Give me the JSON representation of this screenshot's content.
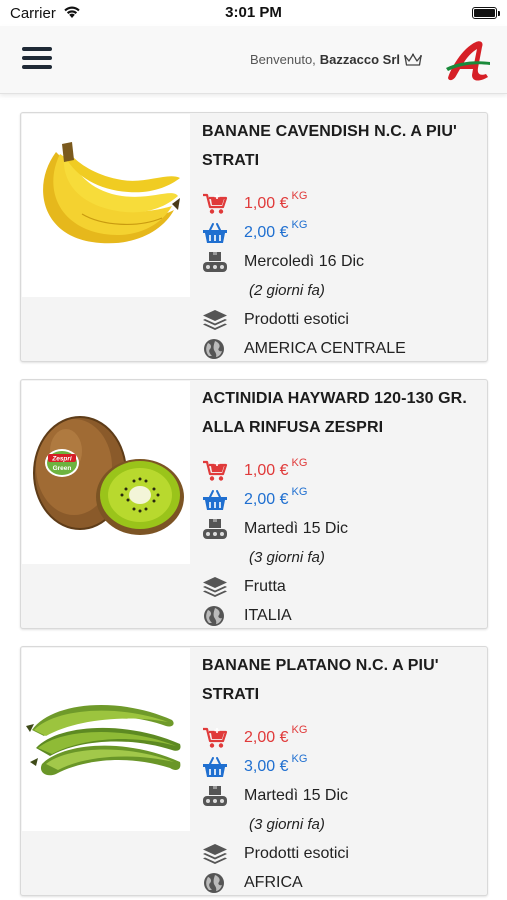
{
  "status_bar": {
    "carrier": "Carrier",
    "time": "3:01 PM"
  },
  "header": {
    "welcome": "Benvenuto,",
    "user": "Bazzacco Srl"
  },
  "products": [
    {
      "title": "BANANE CAVENDISH N.C. A PIU' STRATI",
      "sell_price": "1,00 €",
      "sell_unit": "KG",
      "buy_price": "2,00 €",
      "buy_unit": "KG",
      "date": "Mercoledì 16 Dic",
      "ago": "(2 giorni fa)",
      "category": "Prodotti esotici",
      "origin": "AMERICA CENTRALE",
      "image": "banana-icon"
    },
    {
      "title": "ACTINIDIA HAYWARD 120-130 GR. ALLA RINFUSA ZESPRI",
      "sell_price": "1,00 €",
      "sell_unit": "KG",
      "buy_price": "2,00 €",
      "buy_unit": "KG",
      "date": "Martedì 15 Dic",
      "ago": "(3 giorni fa)",
      "category": "Frutta",
      "origin": "ITALIA",
      "image": "kiwi-icon",
      "label_brand": "Zespri",
      "label_sub": "Green"
    },
    {
      "title": "BANANE PLATANO N.C. A PIU' STRATI",
      "sell_price": "2,00 €",
      "sell_unit": "KG",
      "buy_price": "3,00 €",
      "buy_unit": "KG",
      "date": "Martedì 15 Dic",
      "ago": "(3 giorni fa)",
      "category": "Prodotti esotici",
      "origin": "AFRICA",
      "image": "plantain-icon"
    }
  ],
  "colors": {
    "sell": "#e03a3a",
    "buy": "#1f6fd0",
    "brand": "#d61f26"
  }
}
